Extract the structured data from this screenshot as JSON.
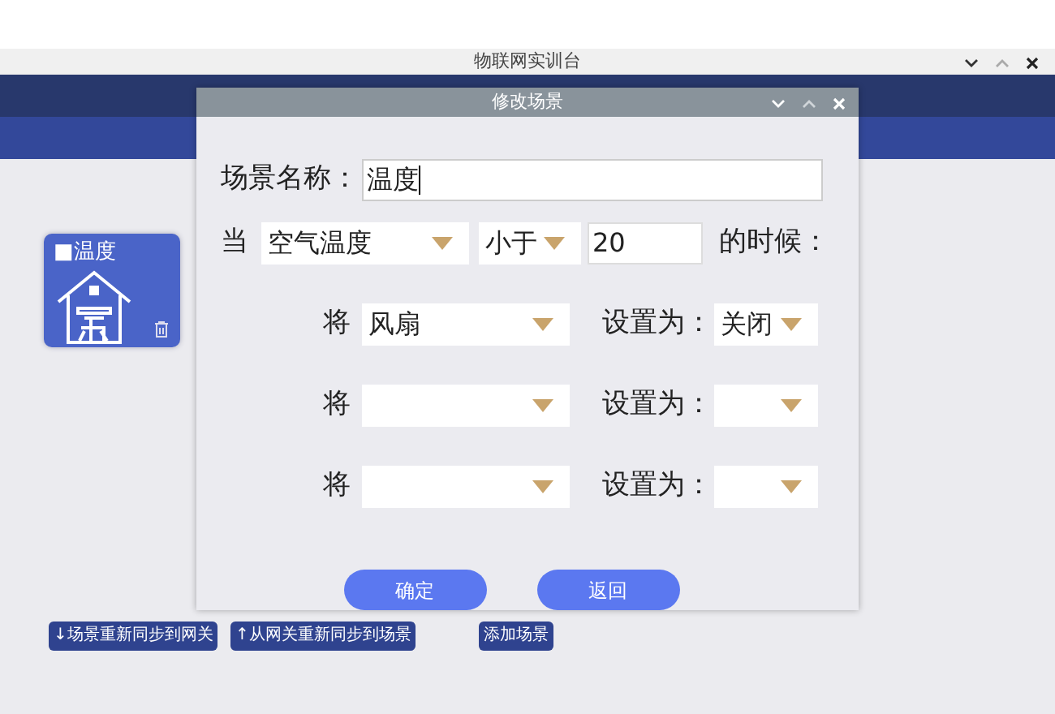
{
  "window": {
    "title": "物联网实训台"
  },
  "scenes": [
    {
      "label": "■温度"
    }
  ],
  "bottom_buttons": [
    {
      "label": "↓场景重新同步到网关"
    },
    {
      "label": "↑从网关重新同步到场景"
    },
    {
      "label": "添加场景"
    }
  ],
  "dialog": {
    "title": "修改场景",
    "name_label": "场景名称：",
    "name_value": "温度",
    "when_label": "当",
    "sensor": "空气温度",
    "comparison": "小于",
    "threshold": "20",
    "when_suffix": "的时候：",
    "actions": [
      {
        "label": "将",
        "device": "风扇",
        "set_label": "设置为：",
        "state": "关闭"
      },
      {
        "label": "将",
        "set_label": "设置为："
      },
      {
        "label": "将",
        "set_label": "设置为："
      }
    ],
    "buttons": [
      {
        "label": "确定"
      },
      {
        "label": "返回"
      }
    ]
  }
}
